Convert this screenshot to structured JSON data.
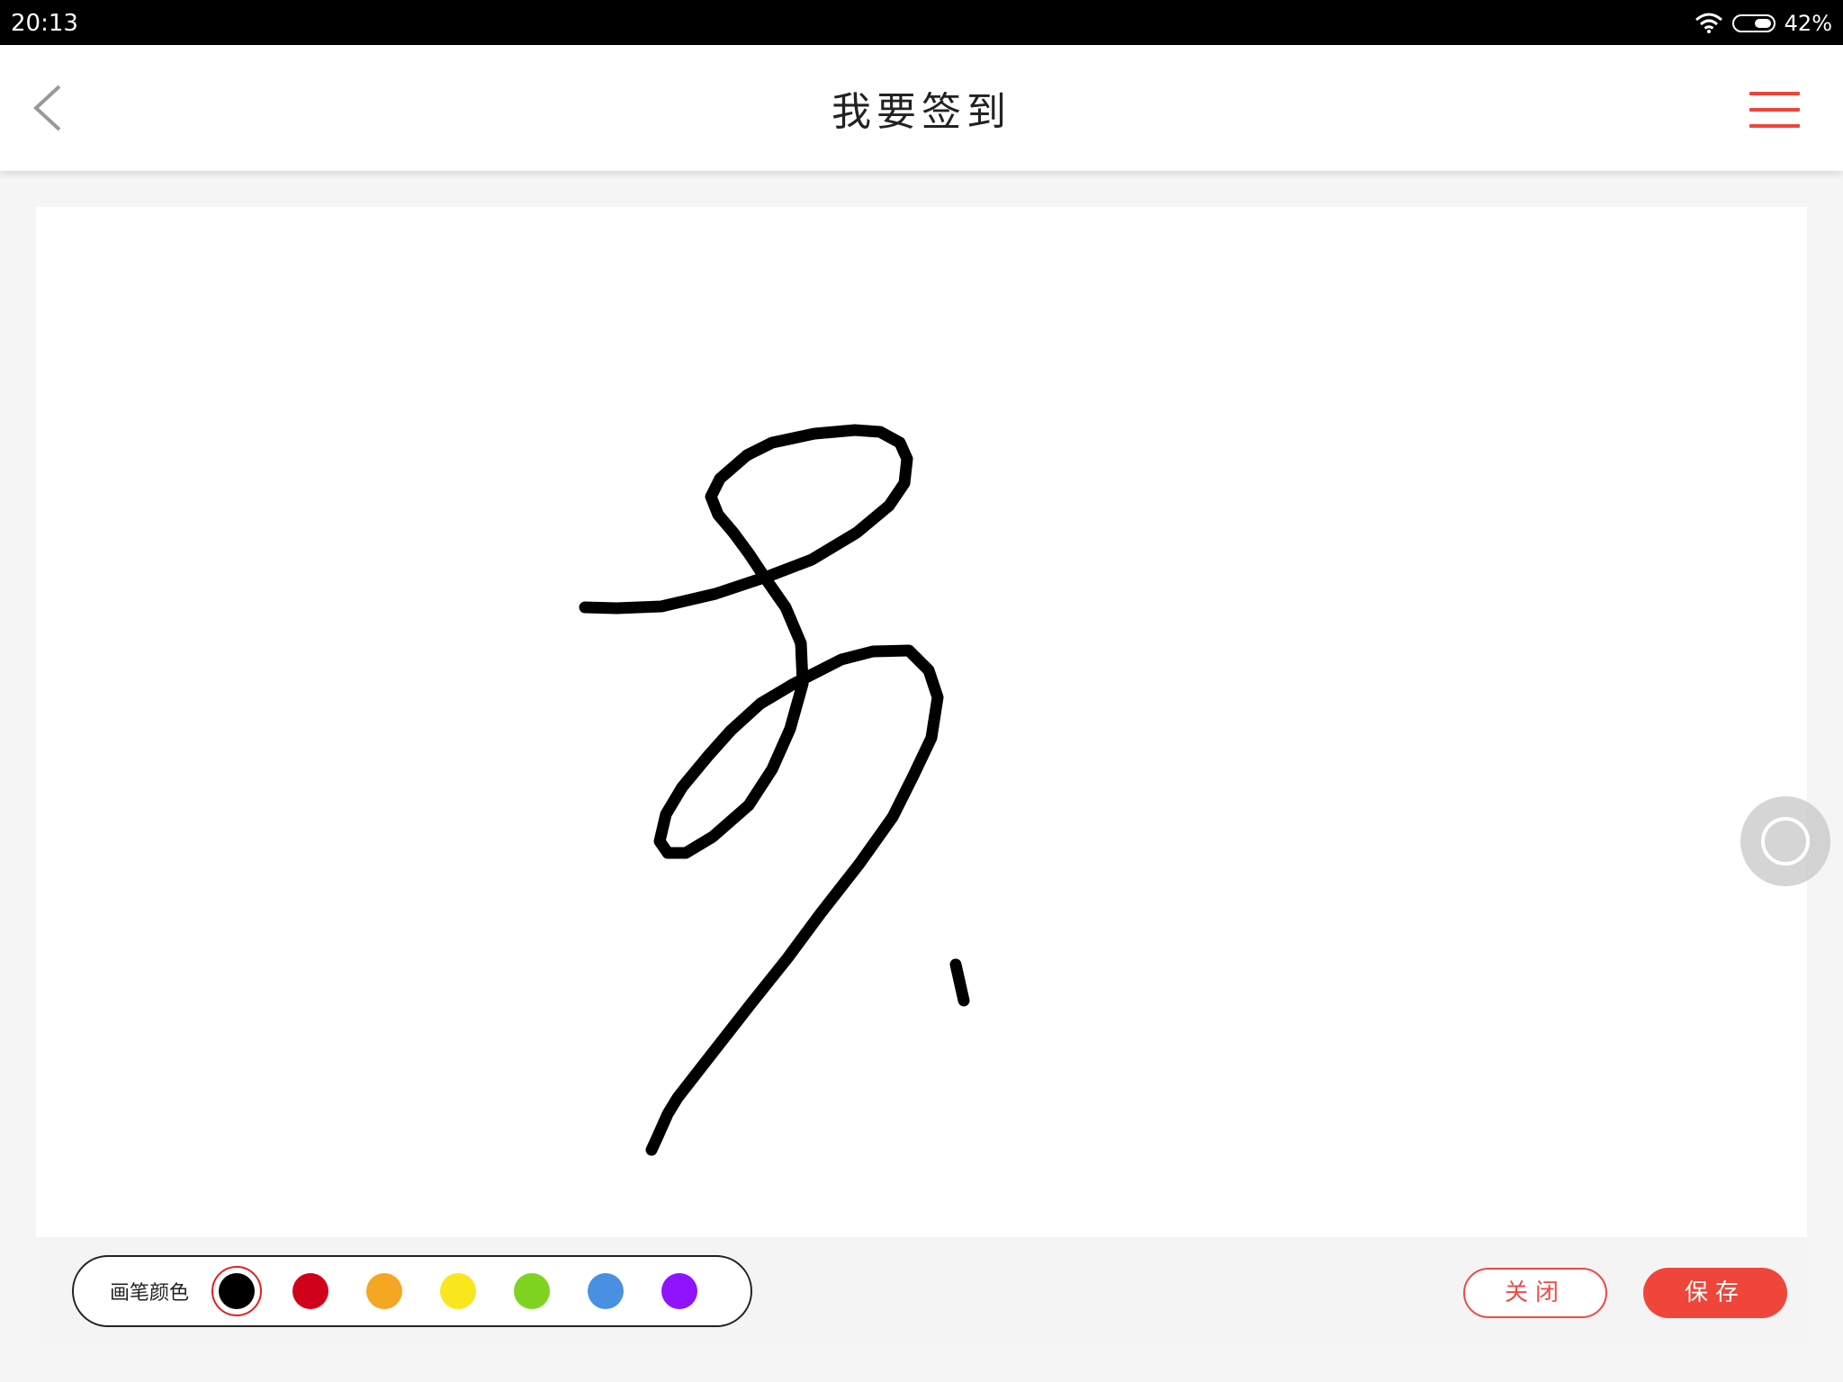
{
  "status_bar": {
    "time": "20:13",
    "battery": "42%",
    "wifi_icon": "wifi-icon",
    "battery_icon": "battery-icon"
  },
  "header": {
    "title": "我要签到",
    "back_icon": "chevron-left-icon",
    "menu_icon": "menu-icon"
  },
  "toolbar": {
    "palette_label": "画笔颜色",
    "colors": [
      {
        "name": "black",
        "hex": "#000000",
        "selected": true
      },
      {
        "name": "red",
        "hex": "#d0021b",
        "selected": false
      },
      {
        "name": "orange",
        "hex": "#f5a623",
        "selected": false
      },
      {
        "name": "yellow",
        "hex": "#f8e71c",
        "selected": false
      },
      {
        "name": "green",
        "hex": "#7ed321",
        "selected": false
      },
      {
        "name": "blue",
        "hex": "#4a90e2",
        "selected": false
      },
      {
        "name": "purple",
        "hex": "#9013fe",
        "selected": false
      }
    ],
    "close_label": "关闭",
    "save_label": "保存"
  },
  "accent_color": "#f0453a"
}
